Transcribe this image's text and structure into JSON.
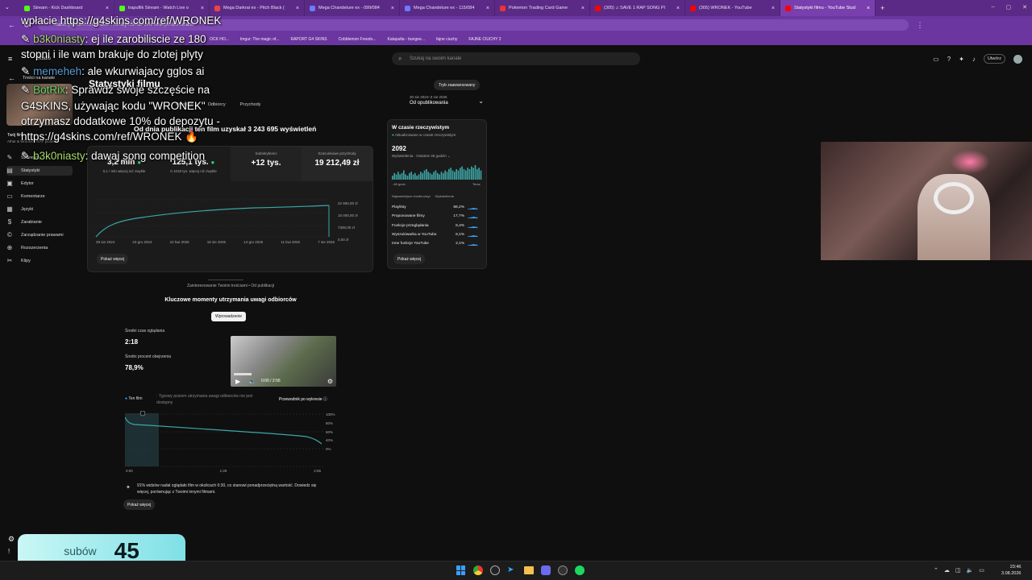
{
  "browser": {
    "tabs": [
      {
        "label": "Stream - Kick Dashboard",
        "color": "#53fc18"
      },
      {
        "label": "trapuflik Stream - Watch Live o",
        "color": "#53fc18"
      },
      {
        "label": "Mega Darkrai ex - Pitch Black (",
        "color": "#e44"
      },
      {
        "label": "Mega Chandelure ex - 099/084",
        "color": "#6b7cff"
      },
      {
        "label": "Mega Chandelure ex - 115/084",
        "color": "#6b7cff"
      },
      {
        "label": "Pokemon Trading Card Game",
        "color": "#e33"
      },
      {
        "label": "(305) ♫ SAVE 1 RAP SONG PI",
        "color": "#f00"
      },
      {
        "label": "(305) WRONEK - YouTube",
        "color": "#f00"
      },
      {
        "label": "Statystyki filmu - YouTube Stud",
        "color": "#f00"
      }
    ],
    "url": "studio.youtube.com/video/.../analytics/tab-overview/period-default",
    "bookmarks": [
      "OCK HO...",
      "Imgur: The magic of...",
      "RAPORT G4 SKINS",
      "Cobblemon Freedo...",
      "Katapulta - bungee...",
      "fajne ciuchy",
      "FAJNE CIUCHY 2"
    ]
  },
  "studio": {
    "logo": "Studio",
    "search_placeholder": "Szukaj na swoim kanale",
    "create_label": "Utwórz",
    "back_label": "Treści na kanale",
    "page_title": "Statystyki filmu",
    "advanced_label": "Tryb zaawansowany",
    "date_range": "30 sie 2024–3 sie 2026",
    "date_period": "Od opublikowania",
    "tabs": [
      "Przegląd",
      "Odbiorcy",
      "Przychody"
    ],
    "summary": "Od dnia publikacji ten film uzyskał 3 243 695 wyświetleń",
    "sidebar": [
      {
        "label": "Szczegóły",
        "icon": "pencil-icon"
      },
      {
        "label": "Statystyki",
        "icon": "analytics-icon"
      },
      {
        "label": "Edytor",
        "icon": "editor-icon"
      },
      {
        "label": "Komentarze",
        "icon": "comment-icon"
      },
      {
        "label": "Języki",
        "icon": "language-icon"
      },
      {
        "label": "Zarabianie",
        "icon": "dollar-icon"
      },
      {
        "label": "Zarządzanie prawami",
        "icon": "copyright-icon"
      },
      {
        "label": "Rozszerzenia",
        "icon": "rozszerzenia-icon"
      },
      {
        "label": "Klipy",
        "icon": "scissors-icon"
      }
    ],
    "channel_label": "Twój film",
    "channel_sub": "Athar & Wronek z RAP piosenki",
    "metrics": [
      {
        "value": "3,2 mln",
        "sub": "0,1 / mln więcej niż zwykle",
        "badge": "up"
      },
      {
        "value": "125,1 tys.",
        "sub": "0 1019 tys. więcej niż zwykle",
        "badge": "up"
      },
      {
        "label": "Subskrybenci",
        "value": "+12 tys."
      },
      {
        "label": "Szacunkowe przychody",
        "value": "19 212,49 zł"
      }
    ],
    "chart_ylabels": [
      "22 900,00 zł",
      "15 000,00 zł",
      "7300,00 zł",
      "0,00 zł"
    ],
    "chart_xlabels": [
      "29 sie 2024",
      "23 gru 2024",
      "22 kwi 2025",
      "18 sie 2025",
      "14 gru 2025",
      "11 kwi 2026",
      "7 sie 2026"
    ],
    "show_more": "Pokaż więcej",
    "realtime": {
      "title": "W czasie rzeczywistym",
      "subtitle": "Aktualizowane w czasie rzeczywistym",
      "value": "2092",
      "views_label": "Wyświetlenia · Ostatnie 48 godzin",
      "left": "-48 godz.",
      "right": "Teraz",
      "col1": "Najważniejsze źródła wizyt",
      "col2": "Wyświetlenia",
      "sources": [
        {
          "name": "Playlisty",
          "pct": "66,2%"
        },
        {
          "name": "Proponowane filmy",
          "pct": "17,7%"
        },
        {
          "name": "Funkcje przeglądania",
          "pct": "6,4%"
        },
        {
          "name": "Wyszukiwarka w YouTube",
          "pct": "6,1%"
        },
        {
          "name": "Inne funkcje YouTube",
          "pct": "2,1%"
        }
      ],
      "bars": [
        3,
        5,
        4,
        6,
        4,
        5,
        7,
        4,
        3,
        5,
        6,
        4,
        5,
        3,
        4,
        6,
        5,
        7,
        8,
        6,
        5,
        4,
        6,
        7,
        5,
        4,
        6,
        5,
        7,
        6,
        8,
        9,
        7,
        6,
        8,
        7,
        9,
        10,
        8,
        7,
        9,
        8,
        10,
        9,
        11,
        8,
        9,
        7
      ]
    },
    "retention": {
      "header": "Zainteresowanie Twoimi treściami • Od publikacji",
      "title": "Kluczowe momenty utrzymania uwagi odbiorców",
      "chip": "Wprowadzenie",
      "avg_time_label": "Średni czas oglądania",
      "avg_time": "2:18",
      "avg_pct_label": "Średni procent obejrzenia",
      "avg_pct": "78,9%",
      "video_time": "0:00 / 2:56",
      "legend1": "Ten film",
      "legend2": "Typowy poziom utrzymania uwagi odbiorców nie jest dostępny",
      "guide": "Przewodnik po wykresie",
      "y_labels": [
        "100%",
        "80%",
        "60%",
        "40%",
        "0%"
      ],
      "x_labels": [
        "0:00",
        "1:28",
        "2:56"
      ],
      "note": "91% widzów nadal oglądało film w okolicach 0:30, co stanowi ponadprzeciętną wartość. Dowiedz się więcej, porównując z Twoimi innymi filmami.",
      "show_more": "Pokaż więcej"
    }
  },
  "overlay": {
    "chat": [
      {
        "text": "wpłacie https://g4skins.com/ref/WRONEK"
      },
      {
        "user": "b3k0niasty",
        "text": ": ej ile zarobiliscie ze 180"
      },
      {
        "text": "stopni i ile wam brakuje do zlotej plyty"
      },
      {
        "user": "memeheh",
        "text": ": ale wkurwiajacy gglos ai"
      },
      {
        "user": "BotRix",
        "text": ": Sprawdź swoje szczęście na"
      },
      {
        "text": "G4SKINS, używając kodu \"WRONEK\""
      },
      {
        "text": "otrzymasz dodatkowe 10% do depozytu -"
      },
      {
        "text": "https://g4skins.com/ref/WRONEK 🔥"
      },
      {
        "user": "b3k0niasty",
        "text": ": dawaj song competition"
      }
    ],
    "subs_label": "subów",
    "subs_count": "45"
  },
  "taskbar": {
    "time": "23:46",
    "date": "3.08.2026"
  }
}
